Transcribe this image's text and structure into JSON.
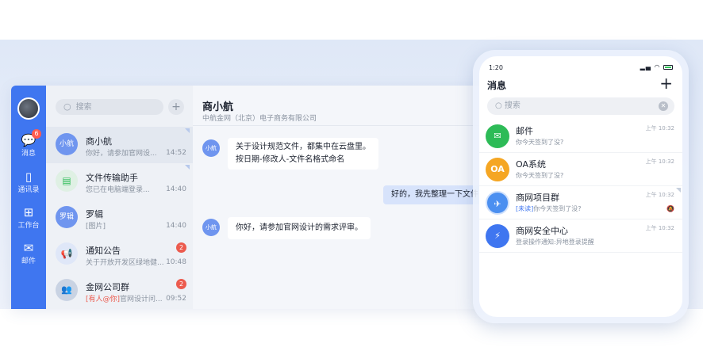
{
  "nav": {
    "items": [
      {
        "label": "消息",
        "icon": "chat-bubble-icon",
        "badge": "6"
      },
      {
        "label": "通讯录",
        "icon": "contacts-icon"
      },
      {
        "label": "工作台",
        "icon": "grid-icon"
      },
      {
        "label": "邮件",
        "icon": "mail-icon"
      }
    ]
  },
  "list": {
    "search_placeholder": "搜索",
    "add_icon": "+",
    "conversations": [
      {
        "avatar": "小航",
        "name": "商小航",
        "preview": "你好，请参加官网设...",
        "time": "14:52",
        "color": "#6f95ef"
      },
      {
        "avatar": "",
        "name": "文件传输助手",
        "preview": "您已在电脑端登录...",
        "time": "14:40",
        "color": "#dff0e4"
      },
      {
        "avatar": "罗辑",
        "name": "罗辑",
        "preview": "[图片]",
        "time": "14:40",
        "color": "#6f95ef"
      },
      {
        "avatar": "",
        "name": "通知公告",
        "preview": "关于开放开发区绿地健...",
        "time": "10:48",
        "count": "2",
        "color": "#dfe7f8"
      },
      {
        "avatar": "",
        "name": "金网公司群",
        "preview_tag": "[有人@你]",
        "preview": "官网设计问...",
        "time": "09:52",
        "count": "2",
        "color": "#c9d3e3"
      }
    ]
  },
  "chat": {
    "title": "商小航",
    "org": "中航金网（北京）电子商务有限公司",
    "messages": [
      {
        "avatar": "小航",
        "line1": "关于设计规范文件，都集中在云盘里。",
        "line2": "按日期-修改人-文件名格式命名"
      },
      {
        "mine": true,
        "text": "好的，我先整理一下文件"
      },
      {
        "avatar": "小航",
        "text": "你好，请参加官网设计的需求评审。"
      }
    ]
  },
  "phone": {
    "time": "1:20",
    "title": "消息",
    "search_placeholder": "搜索",
    "rows": [
      {
        "icon": "mail-icon",
        "glyph": "✉",
        "name": "邮件",
        "preview": "你今天签到了没?",
        "time": "上午 10:32",
        "color": "#2dbb57"
      },
      {
        "icon": "oa-icon",
        "glyph": "OA",
        "name": "OA系统",
        "preview": "你今天签到了没?",
        "time": "上午 10:32",
        "color": "#f5a623"
      },
      {
        "icon": "project-group-icon",
        "glyph": "✈",
        "name": "商网项目群",
        "preview_tag": "[未读]",
        "preview": "你今天签到了没?",
        "time": "上午 10:32",
        "color": "#4b8ff0"
      },
      {
        "icon": "shield-icon",
        "glyph": "⚡",
        "name": "商网安全中心",
        "preview": "登录操作通知:异地登录提醒",
        "time": "上午 10:32",
        "color": "#3f76f0"
      }
    ]
  }
}
